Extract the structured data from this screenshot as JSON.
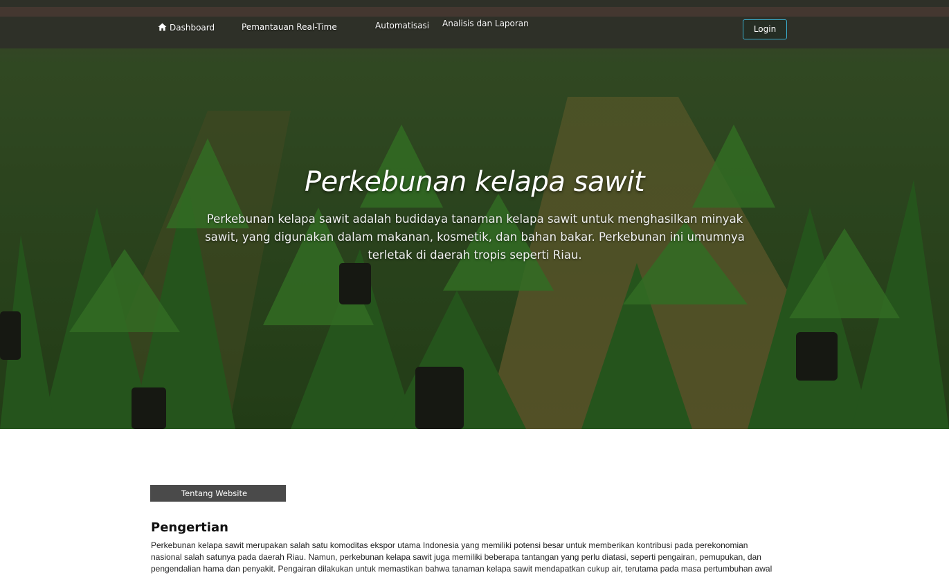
{
  "nav": {
    "items": [
      {
        "label": "Dashboard",
        "icon": "home-icon"
      },
      {
        "label": "Pemantauan Real-Time"
      },
      {
        "label": "Automatisasi"
      },
      {
        "label": "Analisis dan Laporan"
      }
    ],
    "login_label": "Login"
  },
  "hero": {
    "title": "Perkebunan kelapa sawit",
    "description": "Perkebunan kelapa sawit adalah budidaya tanaman kelapa sawit untuk menghasilkan minyak sawit, yang digunakan dalam makanan, kosmetik, dan bahan bakar. Perkebunan ini umumnya terletak di daerah tropis seperti Riau."
  },
  "about": {
    "tab_label": "Tentang Website",
    "heading": "Pengertian",
    "body": "Perkebunan kelapa sawit merupakan salah satu komoditas ekspor utama Indonesia yang memiliki potensi besar untuk memberikan kontribusi pada perekonomian nasional salah satunya pada daerah Riau. Namun, perkebunan kelapa sawit juga memiliki beberapa tantangan yang perlu diatasi, seperti pengairan, pemupukan, dan pengendalian hama dan penyakit. Pengairan dilakukan untuk memastikan bahwa tanaman kelapa sawit mendapatkan cukup air, terutama pada masa pertumbuhan awal"
  },
  "colors": {
    "login_border": "#3bb0d0",
    "tab_bg": "#4a4a4a"
  }
}
